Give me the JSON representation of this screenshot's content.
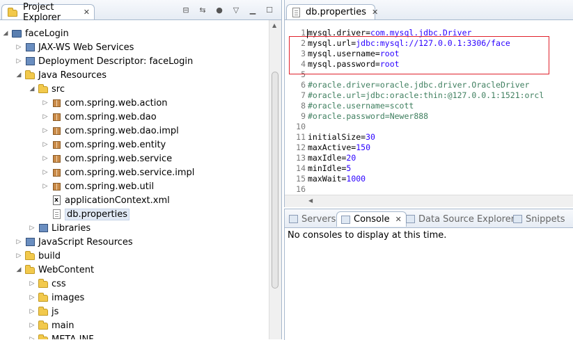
{
  "explorer": {
    "tab_label": "Project Explorer",
    "close_glyph": "✕",
    "tree": [
      {
        "label": "faceLogin",
        "indent": 0,
        "twisty": "open",
        "icon": "project-icon"
      },
      {
        "label": "JAX-WS Web Services",
        "indent": 1,
        "twisty": "closed",
        "icon": "web-services-icon"
      },
      {
        "label": "Deployment Descriptor: faceLogin",
        "indent": 1,
        "twisty": "closed",
        "icon": "descriptor-icon"
      },
      {
        "label": "Java Resources",
        "indent": 1,
        "twisty": "open",
        "icon": "java-resources-icon"
      },
      {
        "label": "src",
        "indent": 2,
        "twisty": "open",
        "icon": "source-folder-icon"
      },
      {
        "label": "com.spring.web.action",
        "indent": 3,
        "twisty": "closed",
        "icon": "package-icon"
      },
      {
        "label": "com.spring.web.dao",
        "indent": 3,
        "twisty": "closed",
        "icon": "package-icon"
      },
      {
        "label": "com.spring.web.dao.impl",
        "indent": 3,
        "twisty": "closed",
        "icon": "package-icon"
      },
      {
        "label": "com.spring.web.entity",
        "indent": 3,
        "twisty": "closed",
        "icon": "package-icon"
      },
      {
        "label": "com.spring.web.service",
        "indent": 3,
        "twisty": "closed",
        "icon": "package-icon"
      },
      {
        "label": "com.spring.web.service.impl",
        "indent": 3,
        "twisty": "closed",
        "icon": "package-icon"
      },
      {
        "label": "com.spring.web.util",
        "indent": 3,
        "twisty": "closed",
        "icon": "package-icon"
      },
      {
        "label": "applicationContext.xml",
        "indent": 3,
        "twisty": "none",
        "icon": "xml-file-icon"
      },
      {
        "label": "db.properties",
        "indent": 3,
        "twisty": "none",
        "icon": "properties-file-icon",
        "selected": true
      },
      {
        "label": "Libraries",
        "indent": 2,
        "twisty": "closed",
        "icon": "libraries-icon"
      },
      {
        "label": "JavaScript Resources",
        "indent": 1,
        "twisty": "closed",
        "icon": "javascript-resources-icon"
      },
      {
        "label": "build",
        "indent": 1,
        "twisty": "closed",
        "icon": "folder-icon"
      },
      {
        "label": "WebContent",
        "indent": 1,
        "twisty": "open",
        "icon": "folder-icon"
      },
      {
        "label": "css",
        "indent": 2,
        "twisty": "closed",
        "icon": "folder-icon"
      },
      {
        "label": "images",
        "indent": 2,
        "twisty": "closed",
        "icon": "folder-icon"
      },
      {
        "label": "js",
        "indent": 2,
        "twisty": "closed",
        "icon": "folder-icon"
      },
      {
        "label": "main",
        "indent": 2,
        "twisty": "closed",
        "icon": "folder-icon"
      },
      {
        "label": "META-INF",
        "indent": 2,
        "twisty": "closed",
        "icon": "folder-icon"
      }
    ]
  },
  "editor": {
    "tab_label": "db.properties",
    "close_glyph": "✕",
    "lines": [
      {
        "n": "1",
        "key": "mysql.driver=",
        "val": "com.mysql.jdbc.Driver",
        "comment": false
      },
      {
        "n": "2",
        "key": "mysql.url=",
        "val": "jdbc:mysql://127.0.0.1:3306/face",
        "comment": false
      },
      {
        "n": "3",
        "key": "mysql.username=",
        "val": "root",
        "comment": false
      },
      {
        "n": "4",
        "key": "mysql.password=",
        "val": "root",
        "comment": false
      },
      {
        "n": "5",
        "key": "",
        "val": "",
        "comment": false
      },
      {
        "n": "6",
        "key": "#oracle.driver=oracle.jdbc.driver.OracleDriver",
        "val": "",
        "comment": true
      },
      {
        "n": "7",
        "key": "#oracle.url=jdbc:oracle:thin:@127.0.0.1:1521:orcl",
        "val": "",
        "comment": true
      },
      {
        "n": "8",
        "key": "#oracle.username=scott",
        "val": "",
        "comment": true
      },
      {
        "n": "9",
        "key": "#oracle.password=Newer888",
        "val": "",
        "comment": true
      },
      {
        "n": "10",
        "key": "",
        "val": "",
        "comment": false
      },
      {
        "n": "11",
        "key": "initialSize=",
        "val": "30",
        "comment": false
      },
      {
        "n": "12",
        "key": "maxActive=",
        "val": "150",
        "comment": false
      },
      {
        "n": "13",
        "key": "maxIdle=",
        "val": "20",
        "comment": false
      },
      {
        "n": "14",
        "key": "minIdle=",
        "val": "5",
        "comment": false
      },
      {
        "n": "15",
        "key": "maxWait=",
        "val": "1000",
        "comment": false
      },
      {
        "n": "16",
        "key": "",
        "val": "",
        "comment": false
      }
    ]
  },
  "bottom": {
    "tabs": [
      {
        "label": "Servers",
        "active": false
      },
      {
        "label": "Console",
        "active": true
      },
      {
        "label": "Data Source Explorer",
        "active": false
      },
      {
        "label": "Snippets",
        "active": false
      }
    ],
    "message": "No consoles to display at this time."
  }
}
